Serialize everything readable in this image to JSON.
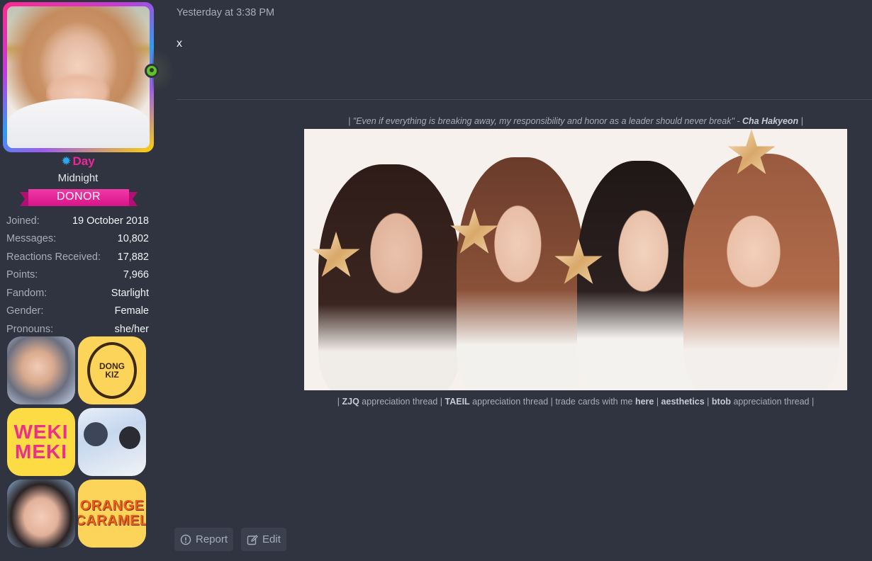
{
  "profile": {
    "username": "Day",
    "username_icon": "sun-icon",
    "user_title": "Midnight",
    "banner": "DONOR",
    "status": "online",
    "stats": [
      {
        "key": "Joined:",
        "value": "19 October 2018"
      },
      {
        "key": "Messages:",
        "value": "10,802"
      },
      {
        "key": "Reactions Received:",
        "value": "17,882"
      },
      {
        "key": "Points:",
        "value": "7,966"
      },
      {
        "key": "Fandom:",
        "value": "Starlight"
      },
      {
        "key": "Gender:",
        "value": "Female"
      },
      {
        "key": "Pronouns:",
        "value": "she/her"
      }
    ],
    "badges": {
      "donkiz": [
        "DONG",
        "KIZ"
      ],
      "wekimeki": [
        "WEKI",
        "MEKI"
      ],
      "orange_caramel": [
        "ORANGE",
        "CARAMEL"
      ]
    }
  },
  "post": {
    "timestamp": "Yesterday at 3:38 PM",
    "message": "x"
  },
  "signature": {
    "quote_prefix": "| \"Even if everything is breaking away, my responsibility and honor as a leader should never break\" - ",
    "quote_author": "Cha Hakyeon",
    "quote_suffix": " |",
    "links": [
      {
        "text": "| "
      },
      {
        "bold": "ZJQ"
      },
      {
        "text": " appreciation thread | "
      },
      {
        "bold": "TAEIL"
      },
      {
        "text": " appreciation thread | trade cards with me "
      },
      {
        "bold": "here"
      },
      {
        "text": " | "
      },
      {
        "bold": "aesthetics"
      },
      {
        "text": " | "
      },
      {
        "bold": "btob"
      },
      {
        "text": " appreciation thread |"
      }
    ]
  },
  "actions": {
    "report": "Report",
    "edit": "Edit"
  },
  "colors": {
    "background": "#2f3440",
    "username": "#f0259a",
    "donor": "#d8148a",
    "online": "#5fc32a"
  }
}
